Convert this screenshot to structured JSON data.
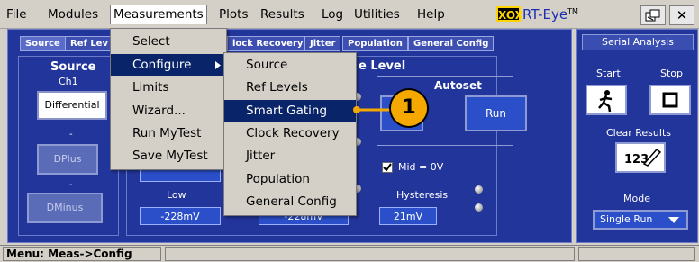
{
  "menubar": {
    "items": [
      "File",
      "Modules",
      "Measurements",
      "Plots",
      "Results",
      "Log",
      "Utilities",
      "Help"
    ],
    "active": "Measurements",
    "logo_mark": "XOX",
    "app_title": "RT-Eye",
    "app_tm": "TM",
    "icon_restore": "restore-icon",
    "close_glyph": "✕"
  },
  "tabs": [
    "Source",
    "Ref Lev",
    "lock Recovery",
    "Jitter",
    "Population",
    "General Config"
  ],
  "source": {
    "title": "Source",
    "channel": "Ch1",
    "mode_button": "Differential",
    "plus_sep": "-",
    "plus_button": "DPlus",
    "minus_sep": "-",
    "minus_button": "DMinus"
  },
  "ref": {
    "section_title": "e Level",
    "autoset_label": "Autoset",
    "run_button": "Run",
    "mid_label": "Mid = 0V",
    "mid_checked": true,
    "low_label": "Low",
    "low_value": "-228mV",
    "mid_value": "-228mV",
    "hysteresis_label": "Hysteresis",
    "hysteresis_value": "21mV"
  },
  "right_panel": {
    "title": "Serial Analysis",
    "start_label": "Start",
    "stop_label": "Stop",
    "start_icon": "running-man-icon",
    "stop_icon": "stop-square-icon",
    "clear_results_label": "Clear Results",
    "clear_icon": "eraser-icon",
    "mode_label": "Mode",
    "mode_value": "Single Run"
  },
  "measurements_menu": [
    "Select",
    "Configure",
    "Limits",
    "Wizard...",
    "Run MyTest",
    "Save MyTest"
  ],
  "configure_submenu": [
    "Source",
    "Ref Levels",
    "Smart Gating",
    "Clock Recovery",
    "Jitter",
    "Population",
    "General Config"
  ],
  "highlighted_submenu_item": "Smart Gating",
  "callout_number": "1",
  "callout_color": "#f5a800",
  "status": "Menu: Meas->Config"
}
